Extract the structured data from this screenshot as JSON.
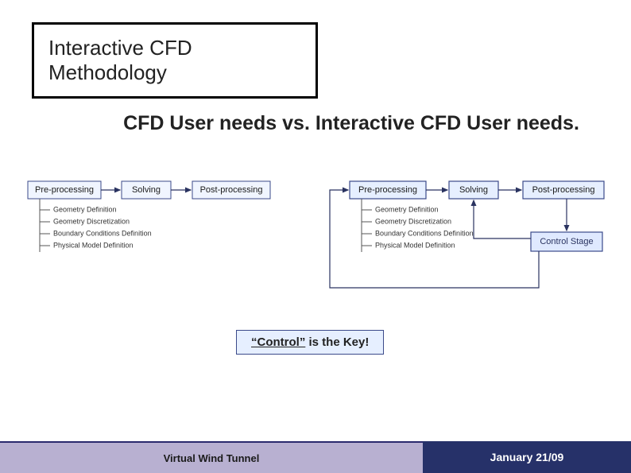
{
  "title": "Interactive CFD Methodology",
  "subtitle": "CFD User needs vs. Interactive CFD User needs.",
  "diagram_left": {
    "stages": [
      "Pre-processing",
      "Solving",
      "Post-processing"
    ],
    "sub_items": [
      "Geometry Definition",
      "Geometry Discretization",
      "Boundary Conditions Definition",
      "Physical Model Definition"
    ]
  },
  "diagram_right": {
    "stages": [
      "Pre-processing",
      "Solving",
      "Post-processing"
    ],
    "sub_items": [
      "Geometry Definition",
      "Geometry Discretization",
      "Boundary Conditions Definition",
      "Physical Model Definition"
    ],
    "control_label": "Control Stage"
  },
  "key_message": {
    "word": "“Control”",
    "rest": " is the Key!"
  },
  "footer": {
    "left": "Virtual Wind Tunnel",
    "right": "January 21/09"
  },
  "chart_data": {
    "type": "diagram",
    "left_flow": {
      "nodes": [
        "Pre-processing",
        "Solving",
        "Post-processing"
      ],
      "edges": [
        [
          "Pre-processing",
          "Solving"
        ],
        [
          "Solving",
          "Post-processing"
        ]
      ],
      "preprocessing_children": [
        "Geometry Definition",
        "Geometry Discretization",
        "Boundary Conditions Definition",
        "Physical Model Definition"
      ]
    },
    "right_flow": {
      "nodes": [
        "Pre-processing",
        "Solving",
        "Post-processing",
        "Control Stage"
      ],
      "edges": [
        [
          "Pre-processing",
          "Solving"
        ],
        [
          "Solving",
          "Post-processing"
        ],
        [
          "Post-processing",
          "Control Stage"
        ],
        [
          "Control Stage",
          "Solving"
        ],
        [
          "Control Stage",
          "Pre-processing"
        ]
      ],
      "preprocessing_children": [
        "Geometry Definition",
        "Geometry Discretization",
        "Boundary Conditions Definition",
        "Physical Model Definition"
      ]
    }
  }
}
